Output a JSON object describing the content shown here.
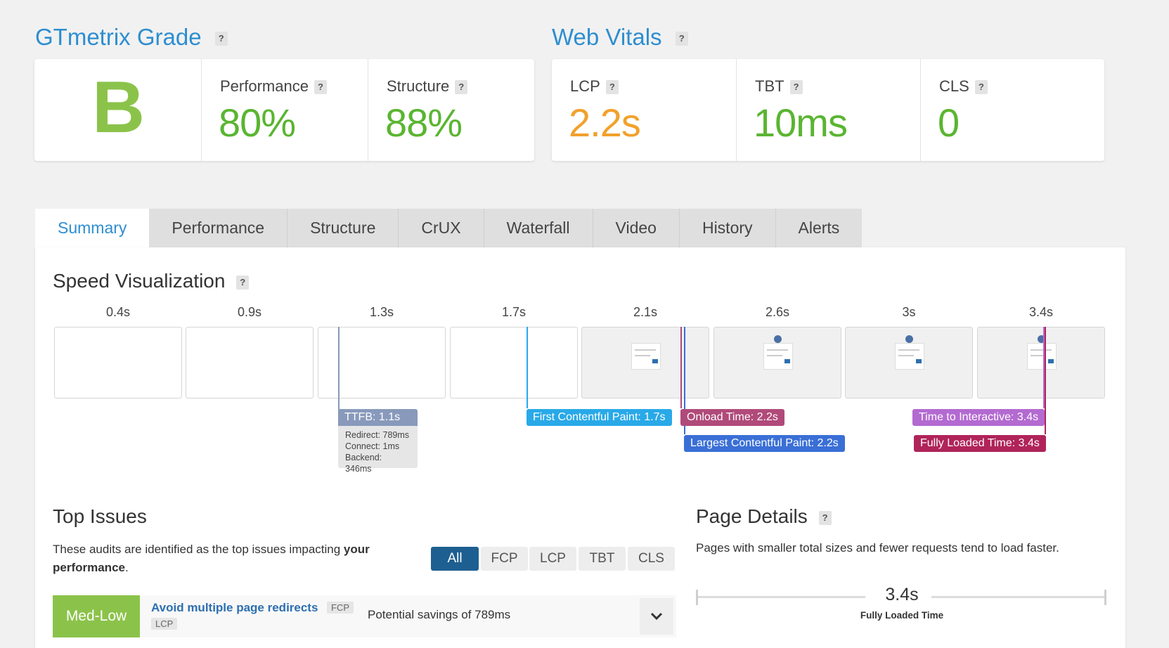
{
  "grade": {
    "title": "GTmetrix Grade",
    "letter": "B",
    "performance": {
      "label": "Performance",
      "value": "80%"
    },
    "structure": {
      "label": "Structure",
      "value": "88%"
    }
  },
  "vitals": {
    "title": "Web Vitals",
    "lcp": {
      "label": "LCP",
      "value": "2.2s",
      "color": "#f1a12c"
    },
    "tbt": {
      "label": "TBT",
      "value": "10ms",
      "color": "#5ab531"
    },
    "cls": {
      "label": "CLS",
      "value": "0",
      "color": "#5ab531"
    }
  },
  "help_glyph": "?",
  "tabs": [
    "Summary",
    "Performance",
    "Structure",
    "CrUX",
    "Waterfall",
    "Video",
    "History",
    "Alerts"
  ],
  "speed": {
    "title": "Speed Visualization",
    "frames": [
      "0.4s",
      "0.9s",
      "1.3s",
      "1.7s",
      "2.1s",
      "2.6s",
      "3s",
      "3.4s"
    ],
    "ttfb": {
      "label": "TTFB: 1.1s",
      "redirect": "Redirect: 789ms",
      "connect": "Connect: 1ms",
      "backend": "Backend: 346ms"
    },
    "fcp": "First Contentful Paint: 1.7s",
    "onload": "Onload Time: 2.2s",
    "lcp": "Largest Contentful Paint: 2.2s",
    "tti": "Time to Interactive: 3.4s",
    "fully": "Fully Loaded Time: 3.4s"
  },
  "issues": {
    "title": "Top Issues",
    "desc_pre": "These audits are identified as the top issues impacting ",
    "desc_bold1": "your",
    "desc_bold2": "performance",
    "desc_post": ".",
    "filters": [
      "All",
      "FCP",
      "LCP",
      "TBT",
      "CLS"
    ],
    "first": {
      "severity": "Med-Low",
      "name": "Avoid multiple page redirects",
      "tags": [
        "FCP",
        "LCP"
      ],
      "savings": "Potential savings of 789ms"
    }
  },
  "details": {
    "title": "Page Details",
    "desc": "Pages with smaller total sizes and fewer requests tend to load faster.",
    "value": "3.4s",
    "label": "Fully Loaded Time"
  }
}
